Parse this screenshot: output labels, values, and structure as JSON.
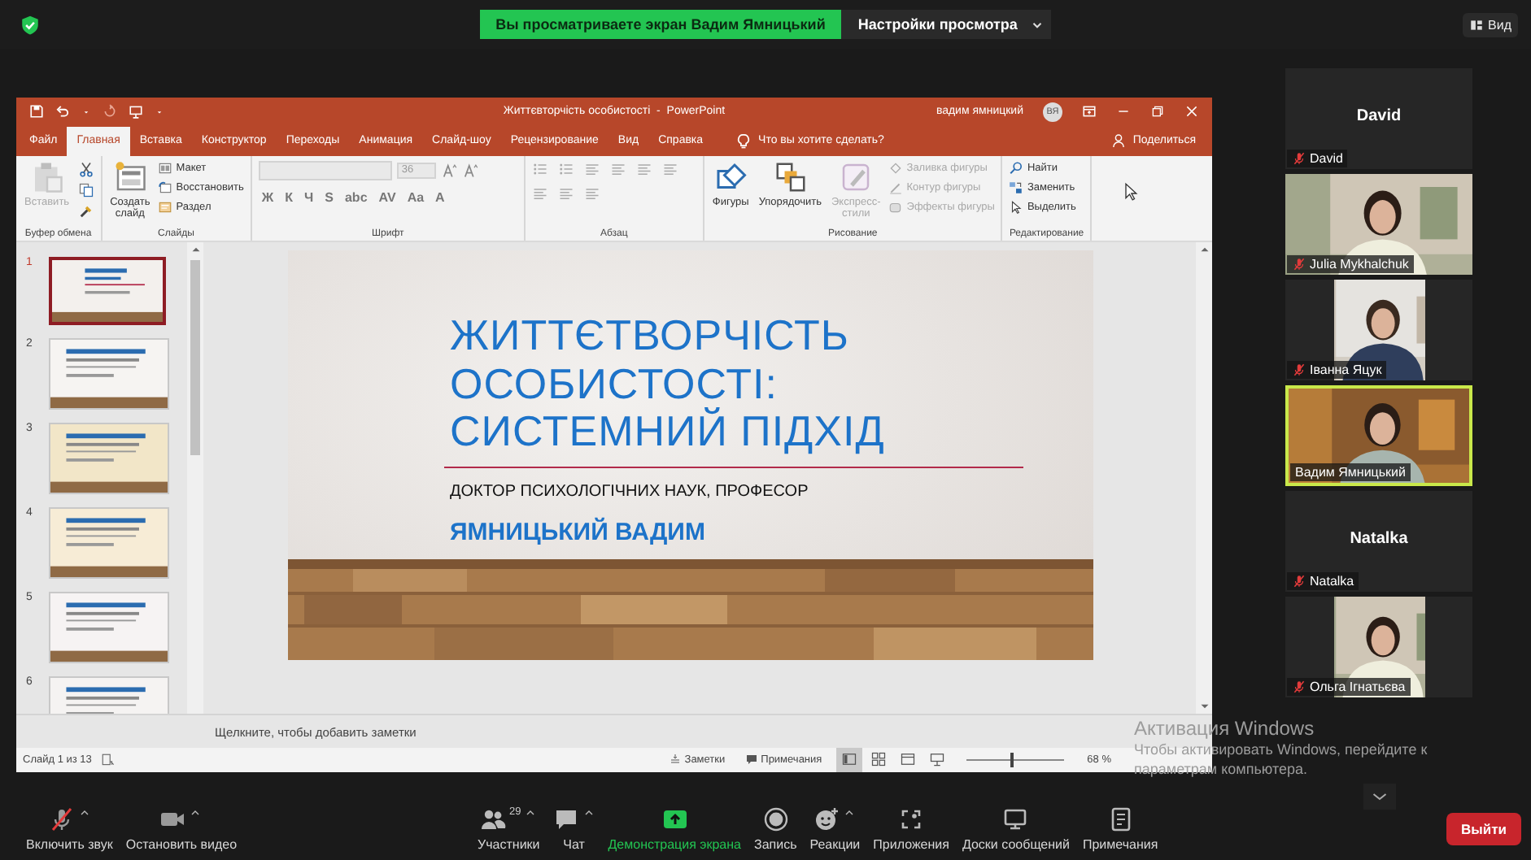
{
  "top_bar": {
    "banner": "Вы просматриваете экран Вадим Ямницький",
    "view_options": "Настройки просмотра",
    "view_button": "Вид"
  },
  "powerpoint": {
    "title": "Життєвторчість особистості  -  PowerPoint",
    "user": "вадим ямницкий",
    "avatar": "ВЯ",
    "tabs": [
      {
        "label": "Файл",
        "selected": false
      },
      {
        "label": "Главная",
        "selected": true
      },
      {
        "label": "Вставка",
        "selected": false
      },
      {
        "label": "Конструктор",
        "selected": false
      },
      {
        "label": "Переходы",
        "selected": false
      },
      {
        "label": "Анимация",
        "selected": false
      },
      {
        "label": "Слайд-шоу",
        "selected": false
      },
      {
        "label": "Рецензирование",
        "selected": false
      },
      {
        "label": "Вид",
        "selected": false
      },
      {
        "label": "Справка",
        "selected": false
      }
    ],
    "tell_me": "Что вы хотите сделать?",
    "share": "Поделиться",
    "ribbon": [
      {
        "kind": "buttons",
        "title": "Буфер обмена",
        "buttons": [
          {
            "kind": "large",
            "label": "Вставить",
            "disabled": true
          },
          {
            "kind": "icon",
            "disabled": false
          },
          {
            "kind": "icon",
            "disabled": false
          },
          {
            "kind": "icon",
            "disabled": false
          }
        ]
      },
      {
        "kind": "buttons",
        "title": "Слайды",
        "buttons": [
          {
            "kind": "large",
            "label": "Создать слайд",
            "disabled": false
          },
          {
            "kind": "small",
            "label": "Макет",
            "disabled": false
          },
          {
            "kind": "small",
            "label": "Восстановить",
            "disabled": false
          },
          {
            "kind": "small",
            "label": "Раздел",
            "disabled": false
          }
        ]
      },
      {
        "kind": "font",
        "title": "Шрифт",
        "font_size": "36",
        "format_buttons": [
          "Ж",
          "К",
          "Ч",
          "S",
          "abc",
          "AV",
          "Aa",
          "A"
        ]
      },
      {
        "kind": "paragraph",
        "title": "Абзац"
      },
      {
        "kind": "buttons",
        "title": "Рисование",
        "buttons": [
          {
            "kind": "large",
            "label": "Фигуры",
            "disabled": false
          },
          {
            "kind": "large",
            "label": "Упорядочить",
            "disabled": false
          },
          {
            "kind": "large",
            "label": "Экспресс-стили",
            "disabled": true
          },
          {
            "kind": "small",
            "label": "Заливка фигуры",
            "disabled": true
          },
          {
            "kind": "small",
            "label": "Контур фигуры",
            "disabled": true
          },
          {
            "kind": "small",
            "label": "Эффекты фигуры",
            "disabled": true
          }
        ]
      },
      {
        "kind": "buttons",
        "title": "Редактирование",
        "buttons": [
          {
            "kind": "small",
            "label": "Найти",
            "disabled": false
          },
          {
            "kind": "small",
            "label": "Заменить",
            "disabled": false
          },
          {
            "kind": "small",
            "label": "Выделить",
            "disabled": false
          }
        ]
      }
    ],
    "thumbnails": [
      {
        "number": "1",
        "selected": true
      },
      {
        "number": "2",
        "selected": false
      },
      {
        "number": "3",
        "selected": false
      },
      {
        "number": "4",
        "selected": false
      },
      {
        "number": "5",
        "selected": false
      },
      {
        "number": "6",
        "selected": false
      }
    ],
    "slide": {
      "title_lines": [
        "ЖИТТЄТВОРЧІСТЬ",
        "ОСОБИСТОСТІ:",
        "СИСТЕМНИЙ ПІДХІД"
      ],
      "subtitle": "ДОКТОР ПСИХОЛОГІЧНИХ НАУК, ПРОФЕСОР",
      "author": "ЯМНИЦЬКИЙ ВАДИМ"
    },
    "notes_placeholder": "Щелкните, чтобы добавить заметки",
    "status": {
      "slide_counter": "Слайд 1 из 13",
      "notes": "Заметки",
      "comments": "Примечания",
      "view_buttons": [
        {
          "selected": true
        },
        {
          "selected": false
        },
        {
          "selected": false
        },
        {
          "selected": false
        }
      ],
      "zoom": {
        "level": 0.45,
        "reading": "68 %"
      }
    }
  },
  "participants": [
    {
      "kind": "name_tile",
      "title": "David",
      "name": "David",
      "muted": true,
      "active": false
    },
    {
      "kind": "video",
      "name": "Julia Mykhalchuk",
      "muted": true,
      "active": false
    },
    {
      "kind": "video_portrait",
      "name": "Іванна Яцук",
      "muted": true,
      "active": false
    },
    {
      "kind": "video",
      "name": "Вадим Ямницький",
      "muted": false,
      "active": true
    },
    {
      "kind": "name_tile",
      "title": "Natalka",
      "name": "Natalka",
      "muted": true,
      "active": false
    },
    {
      "kind": "video_portrait",
      "name": "Ольга Ігнатьєва",
      "muted": true,
      "active": false
    }
  ],
  "toolbar": {
    "items": [
      {
        "kind": "mic_off",
        "label": "Включить звук",
        "caret": true,
        "highlighted": false
      },
      {
        "kind": "camera",
        "label": "Остановить видео",
        "caret": true,
        "highlighted": false
      },
      {
        "kind": "people",
        "label": "Участники",
        "count": "29",
        "caret": true,
        "highlighted": false
      },
      {
        "kind": "chat",
        "label": "Чат",
        "caret": true,
        "highlighted": false
      },
      {
        "kind": "share",
        "label": "Демонстрация экрана",
        "caret": false,
        "highlighted": true
      },
      {
        "kind": "record",
        "label": "Запись",
        "caret": false,
        "highlighted": false
      },
      {
        "kind": "reactions",
        "label": "Реакции",
        "caret": true,
        "highlighted": false
      },
      {
        "kind": "apps",
        "label": "Приложения",
        "caret": false,
        "highlighted": false
      },
      {
        "kind": "boards",
        "label": "Доски сообщений",
        "caret": false,
        "highlighted": false
      },
      {
        "kind": "notes",
        "label": "Примечания",
        "caret": false,
        "highlighted": false
      }
    ],
    "exit": "Выйти"
  },
  "watermark": {
    "title": "Активация Windows",
    "text": "Чтобы активировать Windows, перейдите к параметрам компьютера."
  }
}
